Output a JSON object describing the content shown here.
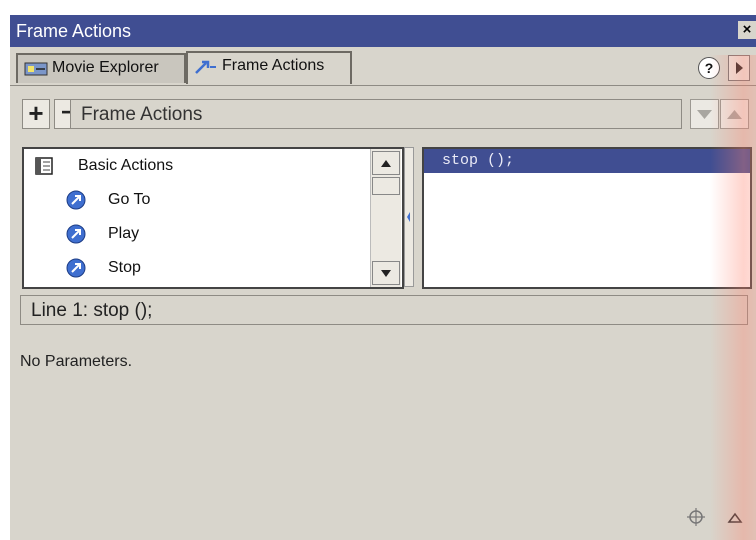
{
  "window": {
    "title": "Frame Actions",
    "close_glyph": "×"
  },
  "tabs": [
    {
      "label": "Movie Explorer",
      "icon": "movie-explorer-icon"
    },
    {
      "label": "Frame Actions",
      "icon": "frame-actions-icon"
    }
  ],
  "header_icons": {
    "help_glyph": "?",
    "menu_arrow": "panel-menu-arrow-icon"
  },
  "toolbar": {
    "add_glyph": "+",
    "remove_glyph": "−",
    "frame_label": "Frame Actions"
  },
  "actions_tree": {
    "category_label": "Basic Actions",
    "category_icon": "book-icon",
    "items": [
      {
        "label": "Go To",
        "icon": "action-arrow-icon"
      },
      {
        "label": "Play",
        "icon": "action-arrow-icon"
      },
      {
        "label": "Stop",
        "icon": "action-arrow-icon"
      }
    ]
  },
  "script": {
    "lines": [
      "stop ();"
    ]
  },
  "status": {
    "line_text": "Line 1: stop ();"
  },
  "parameters": {
    "text": "No Parameters."
  },
  "colors": {
    "title_bar": "#404e92",
    "panel_bg": "#d8d5cc",
    "selected_line": "#404e92",
    "action_icon": "#3f6fd0"
  }
}
